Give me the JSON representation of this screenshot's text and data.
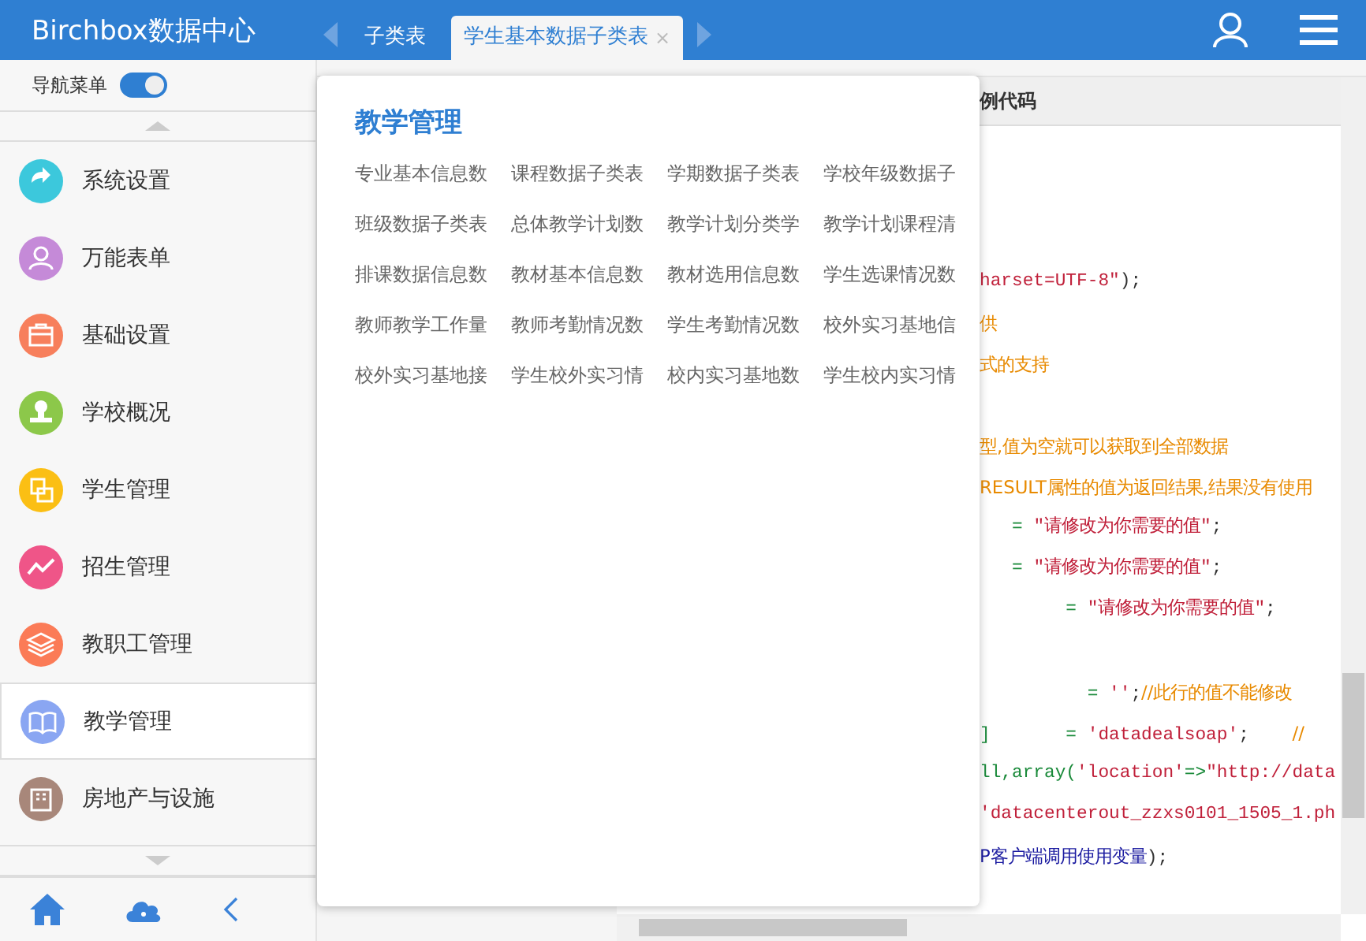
{
  "header": {
    "title": "Birchbox数据中心",
    "tabs": [
      {
        "label": "子类表",
        "selected": false
      },
      {
        "label": "学生基本数据子类表",
        "selected": true
      }
    ],
    "tab_close": "×"
  },
  "sidebar": {
    "toggle": {
      "label": "导航菜单",
      "on": true
    },
    "items": [
      {
        "label": "系统设置",
        "color": "#3cc8dc",
        "selected": false
      },
      {
        "label": "万能表单",
        "color": "#c58ad8",
        "selected": false
      },
      {
        "label": "基础设置",
        "color": "#f77f5c",
        "selected": false
      },
      {
        "label": "学校概况",
        "color": "#8cc84a",
        "selected": false
      },
      {
        "label": "学生管理",
        "color": "#fbbf14",
        "selected": false
      },
      {
        "label": "招生管理",
        "color": "#ef5588",
        "selected": false
      },
      {
        "label": "教职工管理",
        "color": "#fb7b57",
        "selected": false
      },
      {
        "label": "教学管理",
        "color": "#8aa6f2",
        "selected": true
      },
      {
        "label": "房地产与设施",
        "color": "#a8877a",
        "selected": false
      }
    ]
  },
  "popup": {
    "title": "教学管理",
    "links": [
      "专业基本信息数",
      "课程数据子类表",
      "学期数据子类表",
      "学校年级数据子",
      "班级数据子类表",
      "总体教学计划数",
      "教学计划分类学",
      "教学计划课程清",
      "排课数据信息数",
      "教材基本信息数",
      "教材选用信息数",
      "学生选课情况数",
      "教师教学工作量",
      "教师考勤情况数",
      "学生考勤情况数",
      "校外实习基地信",
      "校外实习基地接",
      "学生校外实习情",
      "校内实习基地数",
      "学生校内实习情"
    ]
  },
  "code_panel": {
    "title": "例代码",
    "lines": [
      [
        {
          "text": "harset=UTF-8\"",
          "kind": "string"
        },
        {
          "text": ");",
          "kind": "plain"
        }
      ],
      [
        {
          "text": "供",
          "kind": "comment"
        }
      ],
      [
        {
          "text": "式的支持",
          "kind": "comment"
        }
      ],
      [
        {
          "text": "型,值为空就可以获取到全部数据",
          "kind": "comment"
        }
      ],
      [
        {
          "text": "RESULT属性的值为返回结果,结果没有使用",
          "kind": "comment"
        }
      ],
      [
        {
          "text": "   = ",
          "kind": "op"
        },
        {
          "text": "\"请修改为你需要的值\"",
          "kind": "string"
        },
        {
          "text": ";",
          "kind": "plain"
        }
      ],
      [
        {
          "text": "   = ",
          "kind": "op"
        },
        {
          "text": "\"请修改为你需要的值\"",
          "kind": "string"
        },
        {
          "text": ";",
          "kind": "plain"
        }
      ],
      [
        {
          "text": "        = ",
          "kind": "op"
        },
        {
          "text": "\"请修改为你需要的值\"",
          "kind": "string"
        },
        {
          "text": ";",
          "kind": "plain"
        }
      ],
      [
        {
          "text": "          = ",
          "kind": "op"
        },
        {
          "text": "''",
          "kind": "string"
        },
        {
          "text": ";",
          "kind": "plain"
        },
        {
          "text": "//此行的值不能修改",
          "kind": "comment"
        }
      ],
      [
        {
          "text": "]       = ",
          "kind": "op"
        },
        {
          "text": "'datadealsoap'",
          "kind": "string"
        },
        {
          "text": ";    ",
          "kind": "plain"
        },
        {
          "text": "//",
          "kind": "comment"
        }
      ],
      [
        {
          "text": "ll,array(",
          "kind": "op"
        },
        {
          "text": "'location'",
          "kind": "string"
        },
        {
          "text": "=>",
          "kind": "op"
        },
        {
          "text": "\"http://data",
          "kind": "string"
        }
      ],
      [
        {
          "text": "'datacenterout_zzxs0101_1505_1.ph",
          "kind": "string"
        }
      ],
      [
        {
          "text": "P客户端调用使用变量",
          "kind": "keyword"
        },
        {
          "text": ");",
          "kind": "plain"
        }
      ]
    ]
  }
}
